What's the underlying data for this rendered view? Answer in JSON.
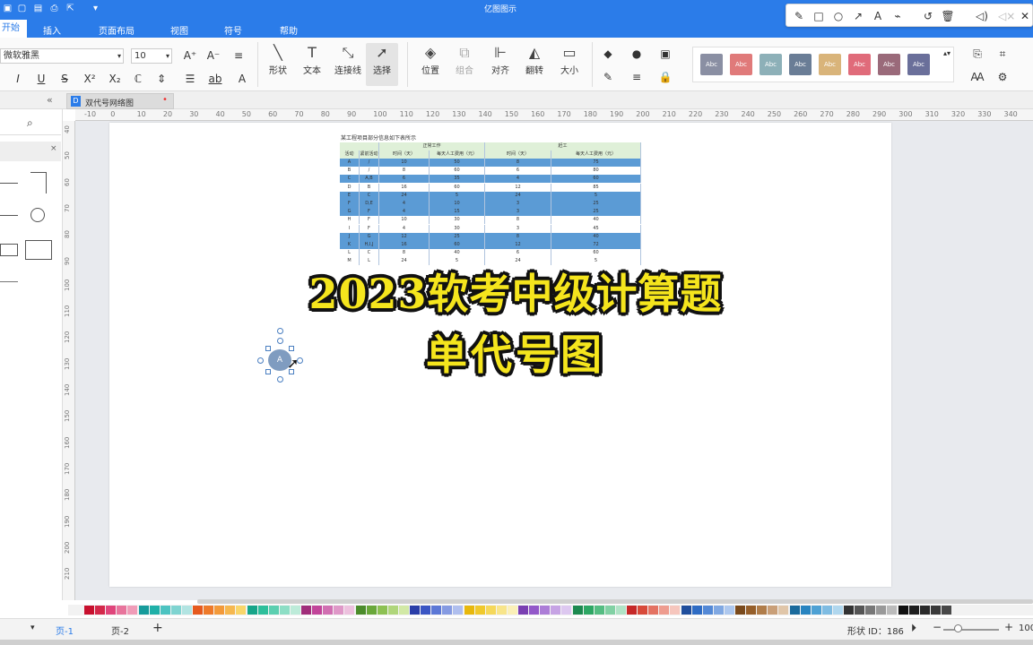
{
  "app": {
    "title": "亿图图示"
  },
  "menu": {
    "active": "开始",
    "items": [
      "插入",
      "页面布局",
      "视图",
      "符号",
      "帮助"
    ]
  },
  "font": {
    "name": "微软雅黑",
    "size": "10"
  },
  "ribbon": {
    "tools": [
      {
        "label": "形状",
        "icon": "line-icon"
      },
      {
        "label": "文本",
        "icon": "text-icon"
      },
      {
        "label": "连接线",
        "icon": "connector-icon"
      },
      {
        "label": "选择",
        "icon": "cursor-icon"
      }
    ],
    "arrange": [
      {
        "label": "位置",
        "icon": "layers-icon"
      },
      {
        "label": "组合",
        "icon": "group-icon"
      },
      {
        "label": "对齐",
        "icon": "align-icon"
      },
      {
        "label": "翻转",
        "icon": "flip-icon"
      },
      {
        "label": "大小",
        "icon": "size-icon"
      }
    ],
    "style_label": "Abc",
    "style_colors": [
      "#8a8fa3",
      "#e07a7a",
      "#8db0b8",
      "#6a7d96",
      "#d9b47a",
      "#e06b7a",
      "#9a6a7a",
      "#6a6f9a"
    ]
  },
  "document": {
    "tab_name": "双代号网络图"
  },
  "ruler": {
    "h_ticks": [
      "-10",
      "0",
      "10",
      "20",
      "30",
      "40",
      "50",
      "60",
      "70",
      "80",
      "90",
      "100",
      "110",
      "120",
      "130",
      "140",
      "150",
      "160",
      "170",
      "180",
      "190",
      "200",
      "210",
      "220",
      "230",
      "240",
      "250",
      "260",
      "270",
      "280",
      "290",
      "300",
      "310",
      "320",
      "330",
      "340"
    ],
    "v_ticks": [
      "40",
      "50",
      "60",
      "70",
      "80",
      "90",
      "100",
      "110",
      "120",
      "130",
      "140",
      "150",
      "160",
      "170",
      "180",
      "190",
      "200",
      "210"
    ]
  },
  "table": {
    "intro": "某工程项目部分信息如下表所示",
    "group_normal": "正常工作",
    "group_crash": "赶工",
    "headers": [
      "活动",
      "紧前活动",
      "时间（天）",
      "每天人工费用（元）",
      "时间（天）",
      "每天人工费用（元）"
    ],
    "rows": [
      [
        "A",
        "/",
        "10",
        "50",
        "8",
        "75"
      ],
      [
        "B",
        "/",
        "8",
        "60",
        "6",
        "80"
      ],
      [
        "C",
        "A,B",
        "6",
        "35",
        "4",
        "60"
      ],
      [
        "D",
        "B",
        "16",
        "60",
        "12",
        "85"
      ],
      [
        "E",
        "C",
        "24",
        "5",
        "24",
        "5"
      ],
      [
        "F",
        "D,E",
        "4",
        "10",
        "3",
        "25"
      ],
      [
        "G",
        "F",
        "4",
        "15",
        "3",
        "25"
      ],
      [
        "H",
        "F",
        "10",
        "30",
        "8",
        "40"
      ],
      [
        "I",
        "F",
        "4",
        "30",
        "3",
        "45"
      ],
      [
        "J",
        "G",
        "12",
        "25",
        "8",
        "40"
      ],
      [
        "K",
        "H,I,J",
        "16",
        "60",
        "12",
        "72"
      ],
      [
        "L",
        "C",
        "8",
        "40",
        "6",
        "60"
      ],
      [
        "M",
        "L",
        "24",
        "5",
        "24",
        "5"
      ]
    ]
  },
  "overlay": {
    "line1": "2023软考中级计算题",
    "line2": "单代号图"
  },
  "shape": {
    "label": "A"
  },
  "status": {
    "page1": "页-1",
    "page2": "页-2",
    "shape_id": "形状 ID：186",
    "zoom": "100"
  },
  "palette": [
    "#c8102e",
    "#d4284a",
    "#e0457b",
    "#e8749c",
    "#f09cb8",
    "#169b9b",
    "#1fb0a8",
    "#4cc3c1",
    "#7fd4d1",
    "#b2e4e2",
    "#e65a1e",
    "#ee7a2a",
    "#f39a3a",
    "#f6b84f",
    "#f9d66a",
    "#17a589",
    "#2ebf9b",
    "#5ccfb0",
    "#8ddec5",
    "#bdebd9",
    "#a12e7b",
    "#c2459a",
    "#d16fb2",
    "#df98c8",
    "#edc1de",
    "#4c8c2b",
    "#6aa83a",
    "#8dc153",
    "#b0d67b",
    "#d2e9a6",
    "#2a3ea8",
    "#3b56c4",
    "#5c78d6",
    "#869be2",
    "#b0bfee",
    "#e8b80c",
    "#f0c92c",
    "#f5d85a",
    "#f8e58a",
    "#fbf0b8",
    "#7a3fb2",
    "#9358c9",
    "#ac7dd7",
    "#c6a3e4",
    "#ddc8f0",
    "#1d8a50",
    "#2ea764",
    "#55bd82",
    "#82d1a4",
    "#b0e3c6",
    "#c62828",
    "#d84a3a",
    "#e47262",
    "#ee9c8f",
    "#f6c6bd",
    "#1f4e9c",
    "#2f6cc4",
    "#5489d6",
    "#80a8e2",
    "#aec8ee",
    "#7a4a1c",
    "#965f2a",
    "#b07d4a",
    "#c99f78",
    "#e0c6a9",
    "#1a6a9c",
    "#2884c0",
    "#4ea1d4",
    "#7fbce2",
    "#b0d7ee",
    "#333333",
    "#555555",
    "#777777",
    "#999999",
    "#bbbbbb",
    "#111111",
    "#1e1e1e",
    "#2b2b2b",
    "#3a3a3a",
    "#484848"
  ]
}
